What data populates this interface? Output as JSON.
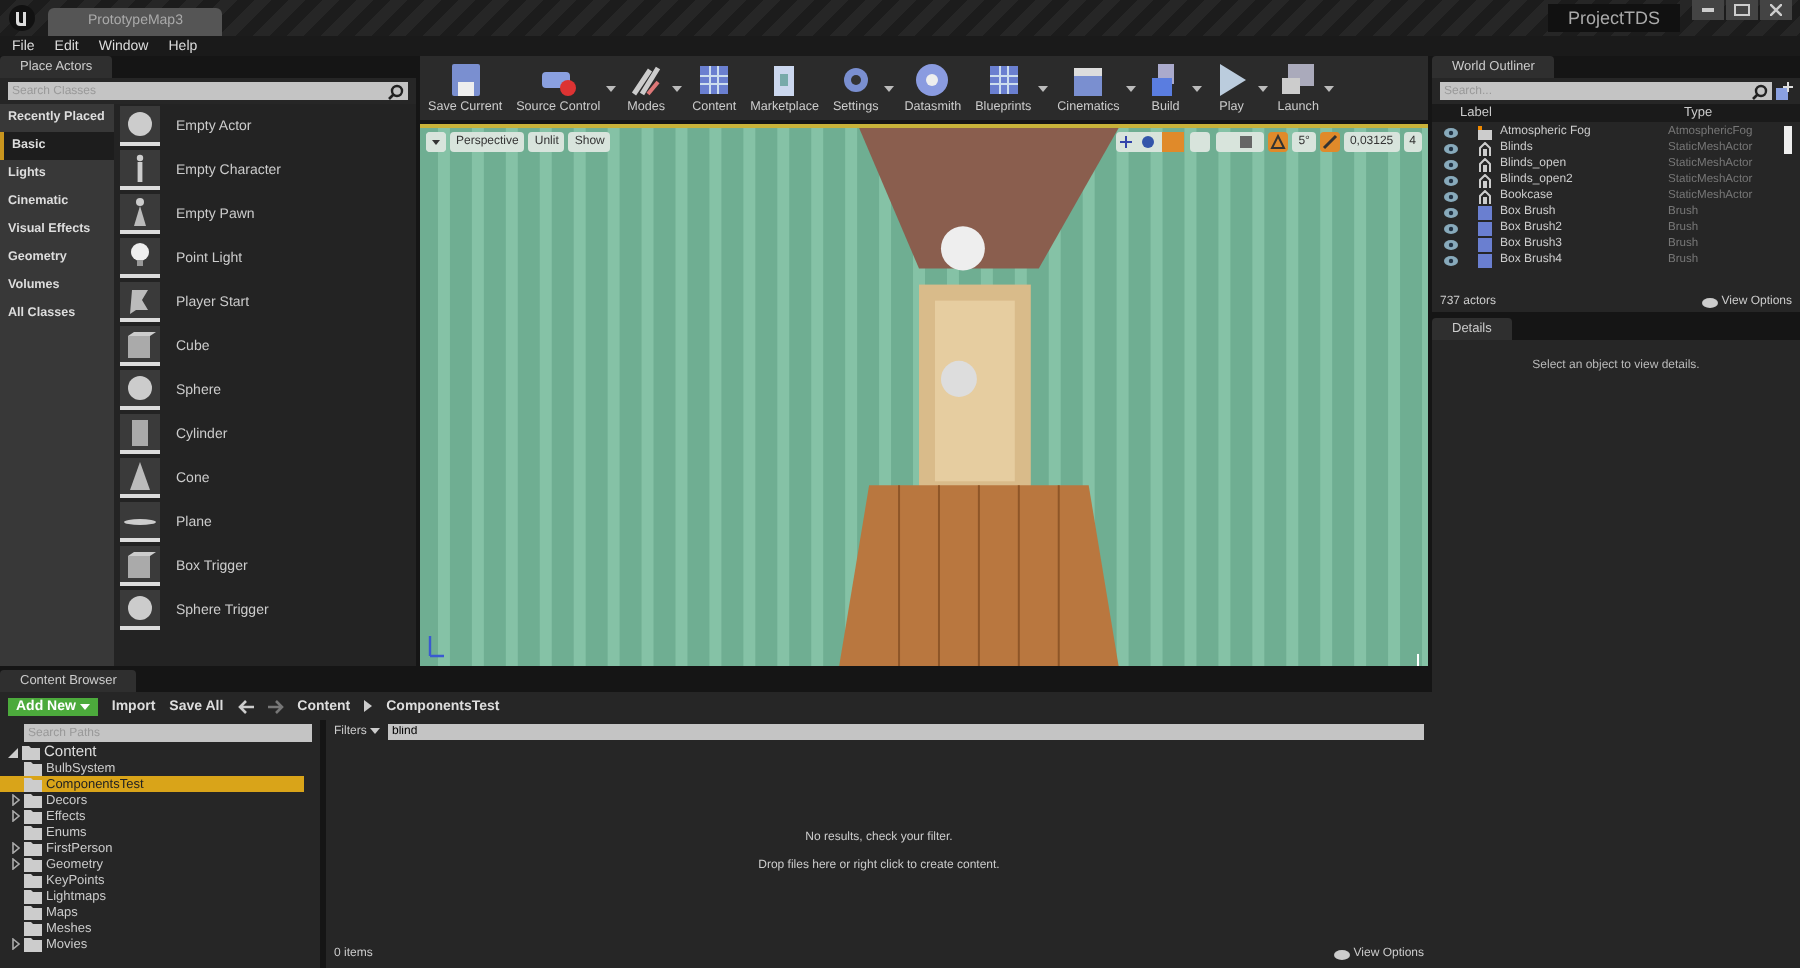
{
  "title_bar": {
    "document_tab": "PrototypeMap3",
    "project": "ProjectTDS"
  },
  "menu": [
    "File",
    "Edit",
    "Window",
    "Help"
  ],
  "place_actors": {
    "title": "Place Actors",
    "search_placeholder": "Search Classes",
    "categories": [
      {
        "label": "Recently Placed",
        "selected": false
      },
      {
        "label": "Basic",
        "selected": true
      },
      {
        "label": "Lights",
        "selected": false
      },
      {
        "label": "Cinematic",
        "selected": false
      },
      {
        "label": "Visual Effects",
        "selected": false
      },
      {
        "label": "Geometry",
        "selected": false
      },
      {
        "label": "Volumes",
        "selected": false
      },
      {
        "label": "All Classes",
        "selected": false
      }
    ],
    "items": [
      {
        "label": "Empty Actor",
        "kind": "sphere"
      },
      {
        "label": "Empty Character",
        "kind": "figure"
      },
      {
        "label": "Empty Pawn",
        "kind": "pawn"
      },
      {
        "label": "Point Light",
        "kind": "bulb"
      },
      {
        "label": "Player Start",
        "kind": "flag"
      },
      {
        "label": "Cube",
        "kind": "cube"
      },
      {
        "label": "Sphere",
        "kind": "sphere"
      },
      {
        "label": "Cylinder",
        "kind": "cylinder"
      },
      {
        "label": "Cone",
        "kind": "cone"
      },
      {
        "label": "Plane",
        "kind": "plane"
      },
      {
        "label": "Box Trigger",
        "kind": "cube"
      },
      {
        "label": "Sphere Trigger",
        "kind": "sphere"
      }
    ]
  },
  "toolbar": [
    {
      "label": "Save Current",
      "kind": "disk",
      "dropdown": false
    },
    {
      "label": "Source Control",
      "kind": "server",
      "dropdown": true
    },
    {
      "label": "Modes",
      "kind": "tools",
      "dropdown": true
    },
    {
      "label": "Content",
      "kind": "grid",
      "dropdown": false
    },
    {
      "label": "Marketplace",
      "kind": "bag",
      "dropdown": false
    },
    {
      "label": "Settings",
      "kind": "gear",
      "dropdown": true
    },
    {
      "label": "Datasmith",
      "kind": "disc",
      "dropdown": false
    },
    {
      "label": "Blueprints",
      "kind": "grid",
      "dropdown": true
    },
    {
      "label": "Cinematics",
      "kind": "clapper",
      "dropdown": true
    },
    {
      "label": "Build",
      "kind": "blocks",
      "dropdown": true
    },
    {
      "label": "Play",
      "kind": "play",
      "dropdown": true
    },
    {
      "label": "Launch",
      "kind": "monitor",
      "dropdown": true
    }
  ],
  "viewport": {
    "view_buttons": [
      "Perspective",
      "Unlit",
      "Show"
    ],
    "angle_snap": "5°",
    "scale_snap": "0,03125",
    "camera_speed": "4"
  },
  "world_outliner": {
    "title": "World Outliner",
    "search_placeholder": "Search...",
    "columns": [
      "Label",
      "Type"
    ],
    "rows": [
      {
        "label": "Atmospheric Fog",
        "type": "AtmosphericFog",
        "kind": "fog"
      },
      {
        "label": "Blinds",
        "type": "StaticMeshActor",
        "kind": "mesh"
      },
      {
        "label": "Blinds_open",
        "type": "StaticMeshActor",
        "kind": "mesh"
      },
      {
        "label": "Blinds_open2",
        "type": "StaticMeshActor",
        "kind": "mesh"
      },
      {
        "label": "Bookcase",
        "type": "StaticMeshActor",
        "kind": "mesh"
      },
      {
        "label": "Box Brush",
        "type": "Brush",
        "kind": "brush"
      },
      {
        "label": "Box Brush2",
        "type": "Brush",
        "kind": "brush"
      },
      {
        "label": "Box Brush3",
        "type": "Brush",
        "kind": "brush"
      },
      {
        "label": "Box Brush4",
        "type": "Brush",
        "kind": "brush"
      }
    ],
    "count": "737 actors",
    "view_options": "View Options"
  },
  "details": {
    "title": "Details",
    "empty_message": "Select an object to view details."
  },
  "content_browser": {
    "title": "Content Browser",
    "add_new": "Add New",
    "import": "Import",
    "save_all": "Save All",
    "path": [
      "Content",
      "ComponentsTest"
    ],
    "search_placeholder": "Search Paths",
    "tree": {
      "label": "Content",
      "expanded": true,
      "children": [
        {
          "label": "BulbSystem",
          "selected": false,
          "expandable": false
        },
        {
          "label": "ComponentsTest",
          "selected": true,
          "expandable": false
        },
        {
          "label": "Decors",
          "selected": false,
          "expandable": true
        },
        {
          "label": "Effects",
          "selected": false,
          "expandable": true
        },
        {
          "label": "Enums",
          "selected": false,
          "expandable": false
        },
        {
          "label": "FirstPerson",
          "selected": false,
          "expandable": true
        },
        {
          "label": "Geometry",
          "selected": false,
          "expandable": true
        },
        {
          "label": "KeyPoints",
          "selected": false,
          "expandable": false
        },
        {
          "label": "Lightmaps",
          "selected": false,
          "expandable": false
        },
        {
          "label": "Maps",
          "selected": false,
          "expandable": false
        },
        {
          "label": "Meshes",
          "selected": false,
          "expandable": false
        },
        {
          "label": "Movies",
          "selected": false,
          "expandable": true
        }
      ]
    },
    "filters": "Filters",
    "filter_value": "blind",
    "empty_message": "No results, check your filter.",
    "drop_hint": "Drop files here or right click to create content.",
    "count": "0 items",
    "view_options": "View Options"
  }
}
